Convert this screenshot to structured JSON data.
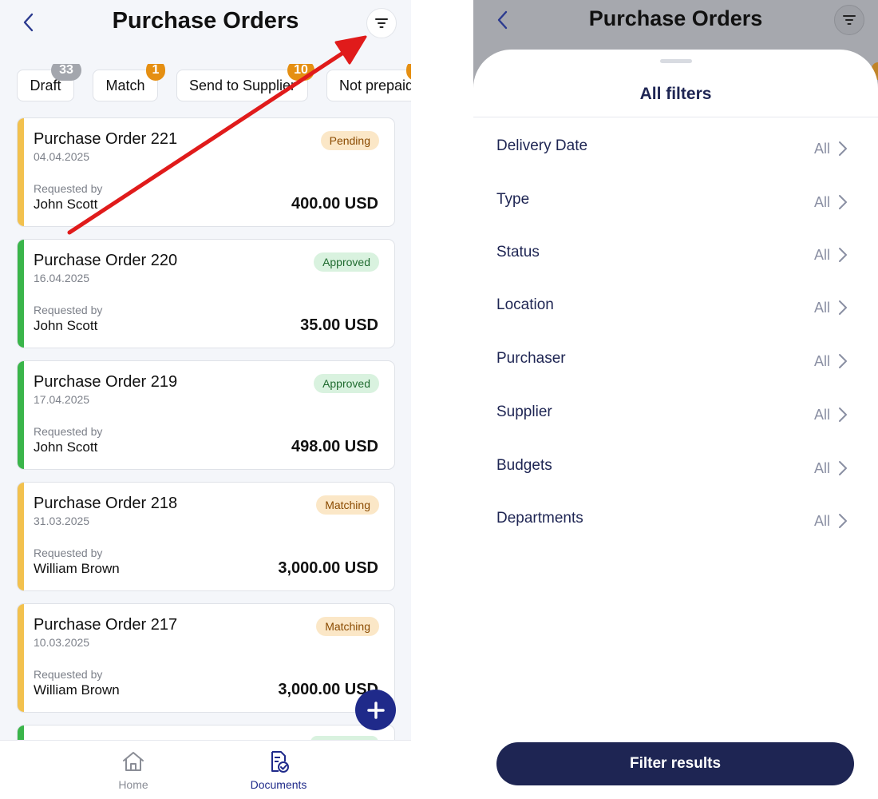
{
  "list_screen": {
    "title": "Purchase Orders",
    "tabs": [
      {
        "label": "Draft",
        "count": "33",
        "badge_color": "#a3a6ad"
      },
      {
        "label": "Match",
        "count": "1",
        "badge_color": "#e58f12"
      },
      {
        "label": "Send to Supplier",
        "count": "10",
        "badge_color": "#e58f12"
      },
      {
        "label": "Not prepaid",
        "count": "",
        "badge_color": "#e58f12"
      }
    ],
    "orders": [
      {
        "title": "Purchase Order 221",
        "date": "04.04.2025",
        "requested_by_label": "Requested by",
        "requester": "John Scott",
        "amount": "400.00 USD",
        "status": "Pending",
        "status_bg": "#fbe7c7",
        "status_fg": "#8a4a00",
        "stripe_color": "#f2c14e"
      },
      {
        "title": "Purchase Order 220",
        "date": "16.04.2025",
        "requested_by_label": "Requested by",
        "requester": "John Scott",
        "amount": "35.00 USD",
        "status": "Approved",
        "status_bg": "#d9f2df",
        "status_fg": "#1f6b2f",
        "stripe_color": "#3ab54a"
      },
      {
        "title": "Purchase Order 219",
        "date": "17.04.2025",
        "requested_by_label": "Requested by",
        "requester": "John Scott",
        "amount": "498.00 USD",
        "status": "Approved",
        "status_bg": "#d9f2df",
        "status_fg": "#1f6b2f",
        "stripe_color": "#3ab54a"
      },
      {
        "title": "Purchase Order 218",
        "date": "31.03.2025",
        "requested_by_label": "Requested by",
        "requester": "William Brown",
        "amount": "3,000.00 USD",
        "status": "Matching",
        "status_bg": "#fbe7c7",
        "status_fg": "#8a4a00",
        "stripe_color": "#f2c14e"
      },
      {
        "title": "Purchase Order 217",
        "date": "10.03.2025",
        "requested_by_label": "Requested by",
        "requester": "William Brown",
        "amount": "3,000.00 USD",
        "status": "Matching",
        "status_bg": "#fbe7c7",
        "status_fg": "#8a4a00",
        "stripe_color": "#f2c14e"
      }
    ],
    "partial_next_stripe_color": "#3ab54a",
    "fab_icon": "plus-icon",
    "bottom_nav": [
      {
        "label": "Home",
        "icon": "home-icon",
        "active": false
      },
      {
        "label": "Documents",
        "icon": "documents-icon",
        "active": true
      }
    ],
    "annotation_arrow_color": "#e01b1b"
  },
  "filters_screen": {
    "title": "Purchase Orders",
    "sheet_title": "All filters",
    "filters": [
      {
        "label": "Delivery Date",
        "value": "All"
      },
      {
        "label": "Type",
        "value": "All"
      },
      {
        "label": "Status",
        "value": "All"
      },
      {
        "label": "Location",
        "value": "All"
      },
      {
        "label": "Purchaser",
        "value": "All"
      },
      {
        "label": "Supplier",
        "value": "All"
      },
      {
        "label": "Budgets",
        "value": "All"
      },
      {
        "label": "Departments",
        "value": "All"
      }
    ],
    "apply_button": "Filter results"
  },
  "colors": {
    "primary": "#1e2553",
    "fab": "#1f2a8a",
    "active_nav": "#1f2a8a",
    "inactive_nav": "#8a8d96"
  }
}
